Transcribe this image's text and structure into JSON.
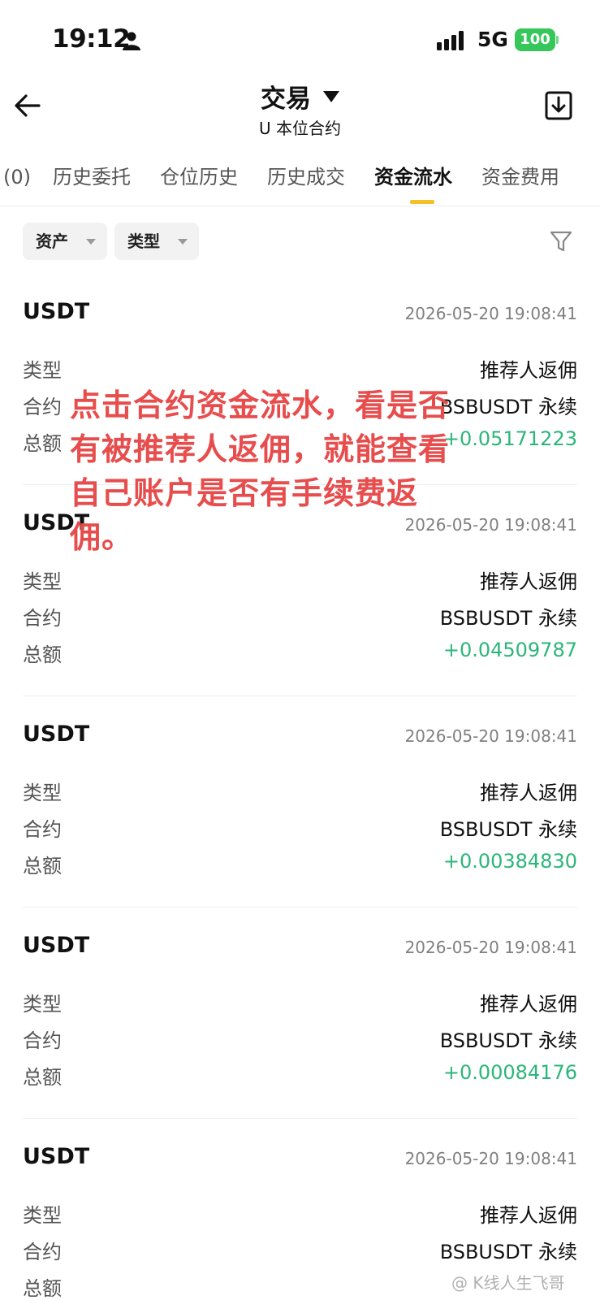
{
  "status_bar": {
    "time": "19:12",
    "network": "5G",
    "battery": "100"
  },
  "header": {
    "title": "交易",
    "subtitle": "U 本位合约"
  },
  "tabs": [
    {
      "label": "(0)"
    },
    {
      "label": "历史委托"
    },
    {
      "label": "仓位历史"
    },
    {
      "label": "历史成交"
    },
    {
      "label": "资金流水"
    },
    {
      "label": "资金费用"
    }
  ],
  "active_tab": "资金流水",
  "filters": {
    "asset_label": "资产",
    "type_label": "类型"
  },
  "field_labels": {
    "type": "类型",
    "contract": "合约",
    "amount": "总额"
  },
  "records": [
    {
      "asset": "USDT",
      "time": "2026-05-20 19:08:41",
      "type": "推荐人返佣",
      "contract": "BSBUSDT 永续",
      "amount": "+0.05171223"
    },
    {
      "asset": "USDT",
      "time": "2026-05-20 19:08:41",
      "type": "推荐人返佣",
      "contract": "BSBUSDT 永续",
      "amount": "+0.04509787"
    },
    {
      "asset": "USDT",
      "time": "2026-05-20 19:08:41",
      "type": "推荐人返佣",
      "contract": "BSBUSDT 永续",
      "amount": "+0.00384830"
    },
    {
      "asset": "USDT",
      "time": "2026-05-20 19:08:41",
      "type": "推荐人返佣",
      "contract": "BSBUSDT 永续",
      "amount": "+0.00084176"
    },
    {
      "asset": "USDT",
      "time": "2026-05-20 19:08:41",
      "type": "推荐人返佣",
      "contract": "BSBUSDT 永续",
      "amount": ""
    }
  ],
  "overlay_note": "点击合约资金流水，看是否有被推荐人返佣，就能查看自己账户是否有手续费返佣。",
  "watermark": "@ K线人生飞哥",
  "colors": {
    "accent": "#f0c12a",
    "positive": "#2bb67a",
    "annotation": "#e84d4d",
    "battery": "#35c759"
  },
  "icons": [
    "person-icon",
    "signal-icon",
    "back-arrow-icon",
    "caret-down-icon",
    "download-icon",
    "filter-icon"
  ]
}
